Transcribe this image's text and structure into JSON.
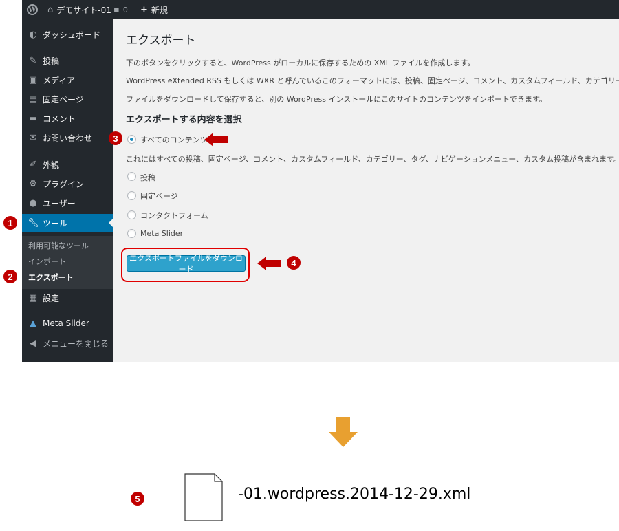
{
  "adminbar": {
    "site_name": "デモサイト-01",
    "comment_count": "0",
    "new_label": "新規"
  },
  "sidebar": {
    "items": [
      {
        "label": "ダッシュボード",
        "icon": "dashboard-icon"
      },
      {
        "label": "投稿",
        "icon": "pin-icon"
      },
      {
        "label": "メディア",
        "icon": "media-icon"
      },
      {
        "label": "固定ページ",
        "icon": "pages-icon"
      },
      {
        "label": "コメント",
        "icon": "comment-icon"
      },
      {
        "label": "お問い合わせ",
        "icon": "mail-icon"
      },
      {
        "label": "外観",
        "icon": "brush-icon"
      },
      {
        "label": "プラグイン",
        "icon": "plugin-icon"
      },
      {
        "label": "ユーザー",
        "icon": "user-icon"
      },
      {
        "label": "ツール",
        "icon": "wrench-icon",
        "current": true
      },
      {
        "label": "設定",
        "icon": "settings-icon"
      },
      {
        "label": "Meta Slider",
        "icon": "image-icon"
      },
      {
        "label": "メニューを閉じる",
        "icon": "collapse-icon"
      }
    ],
    "submenu": [
      {
        "label": "利用可能なツール"
      },
      {
        "label": "インポート"
      },
      {
        "label": "エクスポート",
        "current": true
      }
    ]
  },
  "main": {
    "title": "エクスポート",
    "desc1": "下のボタンをクリックすると、WordPress がローカルに保存するための XML ファイルを作成します。",
    "desc2": "WordPress eXtended RSS もしくは WXR と呼んでいるこのフォーマットには、投稿、固定ページ、コメント、カスタムフィールド、カテゴリー、タグが含まれます。",
    "desc3": "ファイルをダウンロードして保存すると、別の WordPress インストールにこのサイトのコンテンツをインポートできます。",
    "section_title": "エクスポートする内容を選択",
    "options": [
      {
        "label": "すべてのコンテンツ",
        "checked": true
      },
      {
        "label": "投稿"
      },
      {
        "label": "固定ページ"
      },
      {
        "label": "コンタクトフォーム"
      },
      {
        "label": "Meta Slider"
      }
    ],
    "all_content_note": "これにはすべての投稿、固定ページ、コメント、カスタムフィールド、カテゴリー、タグ、ナビゲーションメニュー、カスタム投稿が含まれます。",
    "download_button": "エクスポートファイルをダウンロード"
  },
  "annotations": {
    "step1": "1",
    "step2": "2",
    "step3": "3",
    "step4": "4",
    "step5": "5"
  },
  "result": {
    "filename": "-01.wordpress.2014-12-29.xml"
  },
  "colors": {
    "accent": "#0073aa",
    "button": "#2ea2cc",
    "annotation_red": "#c00000",
    "arrow_orange": "#e8a030"
  }
}
